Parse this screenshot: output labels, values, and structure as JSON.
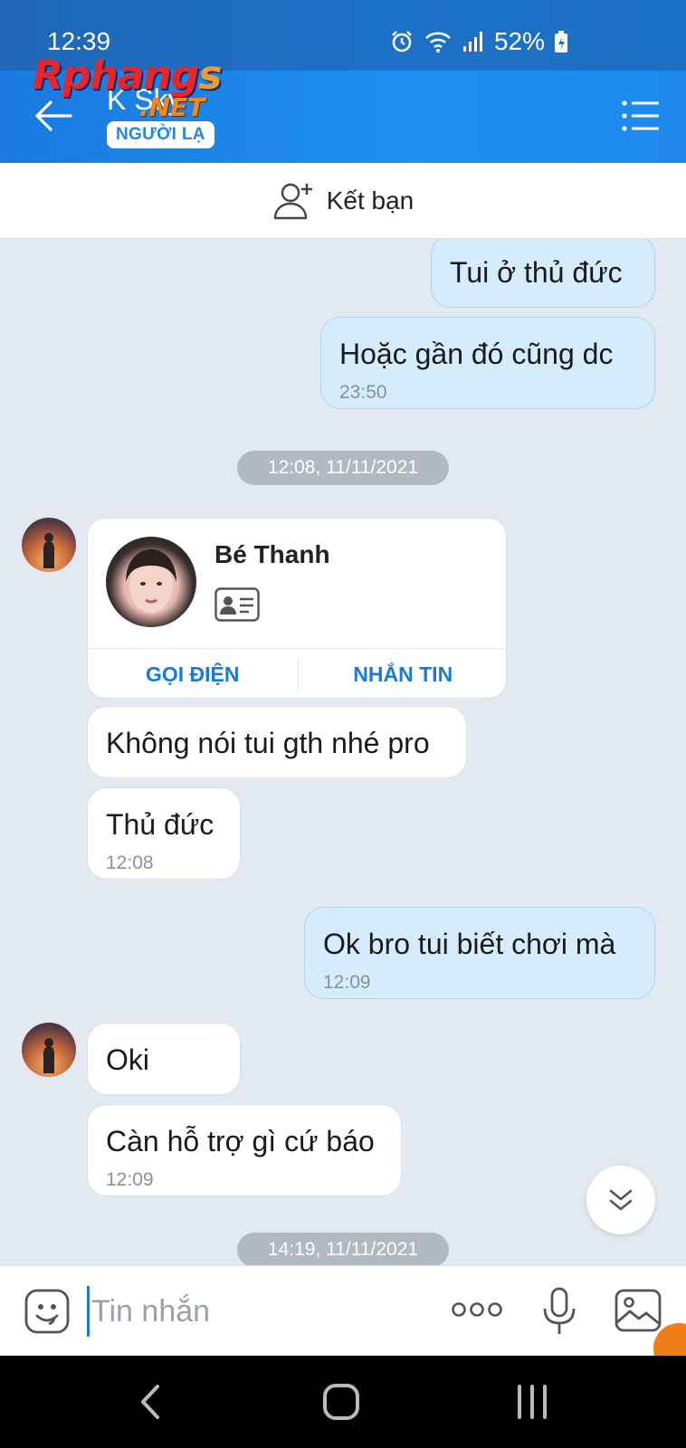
{
  "status_bar": {
    "time": "12:39",
    "battery": "52%"
  },
  "header": {
    "title": "K Sky",
    "badge": "NGƯỜI LẠ"
  },
  "watermark": {
    "main": "Rphang",
    "s": "s",
    "net": ".NET"
  },
  "add_friend": {
    "label": "Kết bạn"
  },
  "messages": [
    {
      "text": "Tui ở thủ đức"
    },
    {
      "text": "Hoặc gần đó cũng dc",
      "time": "23:50"
    },
    {
      "text": "Không nói tui gth nhé pro"
    },
    {
      "text": "Thủ đức",
      "time": "12:08"
    },
    {
      "text": "Ok bro tui biết chơi mà",
      "time": "12:09"
    },
    {
      "text": "Oki"
    },
    {
      "text": "Càn hỗ trợ gì cứ báo",
      "time": "12:09"
    }
  ],
  "date_separators": [
    "12:08, 11/11/2021",
    "14:19, 11/11/2021"
  ],
  "contact_card": {
    "name": "Bé Thanh",
    "call_label": "GỌI ĐIỆN",
    "message_label": "NHẮN TIN"
  },
  "composer": {
    "placeholder": "Tin nhắn"
  },
  "colors": {
    "header": "#1f8ff0",
    "my_bubble": "#d5ecfd",
    "their_bubble": "#ffffff",
    "chat_bg": "#e2e9f1",
    "link_blue": "#1a7ad8"
  },
  "icons": [
    "back-arrow-icon",
    "menu-list-icon",
    "add-person-icon",
    "id-card-icon",
    "chevron-double-down-icon",
    "sticker-icon",
    "more-dots-icon",
    "microphone-icon",
    "image-icon",
    "alarm-icon",
    "wifi-icon",
    "signal-icon",
    "battery-icon"
  ]
}
